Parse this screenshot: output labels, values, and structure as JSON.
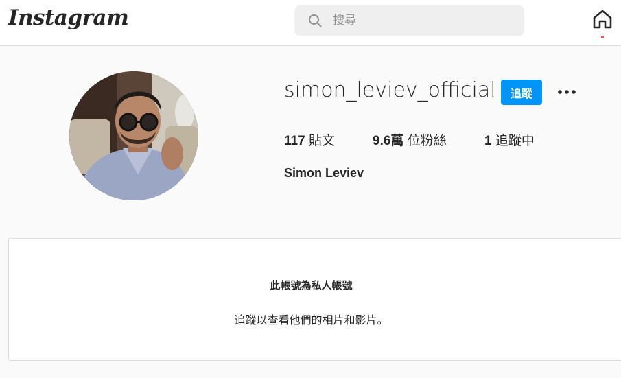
{
  "header": {
    "logo_text": "Instagram",
    "search_placeholder": "搜尋",
    "home_icon": "home-icon",
    "search_icon": "search-icon"
  },
  "profile": {
    "username": "simon_leviev_official",
    "follow_label": "追蹤",
    "more_icon": "more-options-icon",
    "stats": {
      "posts_count": "117",
      "posts_label": "貼文",
      "followers_count": "9.6萬",
      "followers_label": "位粉絲",
      "following_count": "1",
      "following_label": "追蹤中"
    },
    "full_name": "Simon Leviev"
  },
  "private_notice": {
    "title": "此帳號為私人帳號",
    "subtitle": "追蹤以查看他們的相片和影片。"
  },
  "colors": {
    "accent": "#0095f6",
    "notification": "#ed4956",
    "border": "#dbdbdb",
    "page_background": "#fafafa"
  }
}
